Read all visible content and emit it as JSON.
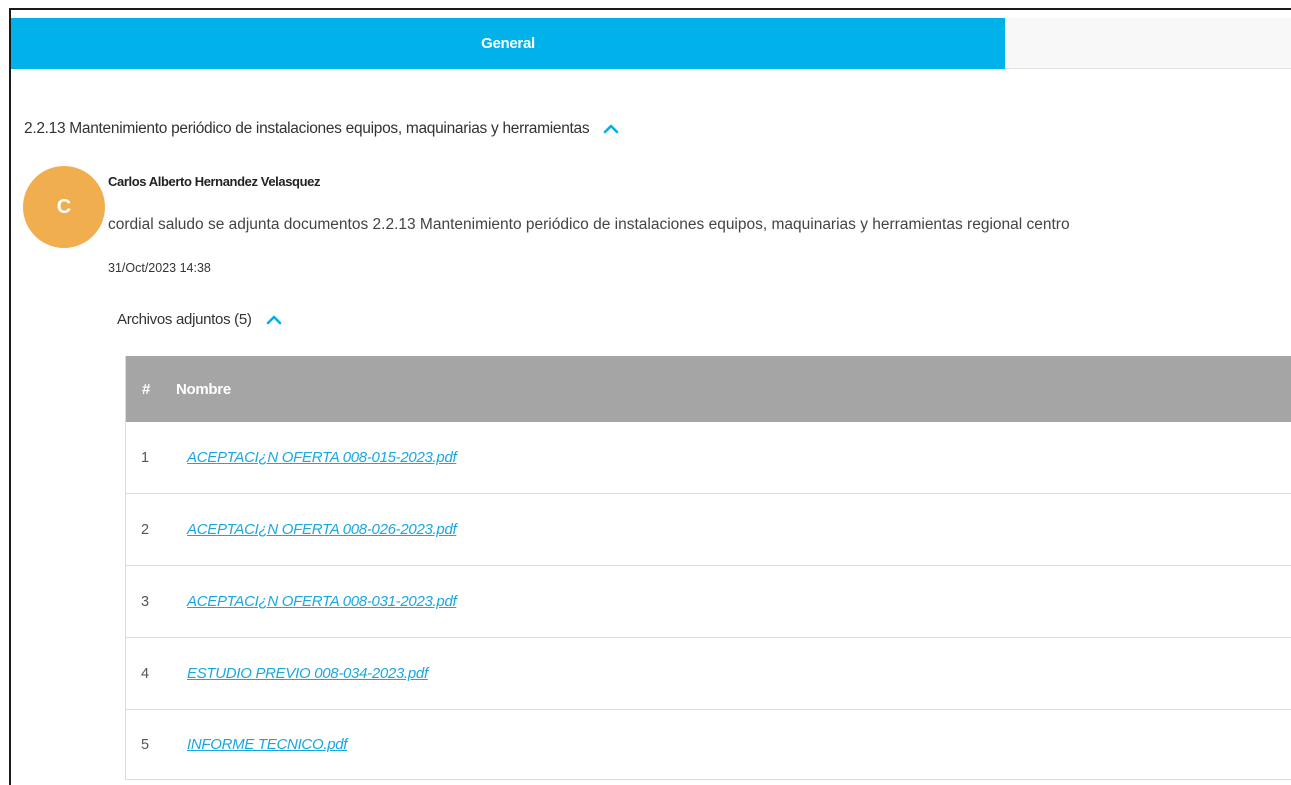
{
  "tabs": [
    {
      "label": "General"
    },
    {
      "label": ""
    }
  ],
  "section": {
    "title": "2.2.13 Mantenimiento periódico de instalaciones equipos, maquinarias y herramientas"
  },
  "comment": {
    "avatar_letter": "C",
    "author": "Carlos Alberto Hernandez Velasquez",
    "text": "cordial saludo se adjunta documentos 2.2.13 Mantenimiento periódico de instalaciones equipos, maquinarias y herramientas regional centro",
    "date": "31/Oct/2023 14:38"
  },
  "attachments": {
    "title": "Archivos adjuntos (5)",
    "columns": [
      "#",
      "Nombre"
    ],
    "rows": [
      {
        "num": "1",
        "name": "ACEPTACI¿N OFERTA 008-015-2023.pdf"
      },
      {
        "num": "2",
        "name": "ACEPTACI¿N OFERTA 008-026-2023.pdf"
      },
      {
        "num": "3",
        "name": "ACEPTACI¿N OFERTA 008-031-2023.pdf"
      },
      {
        "num": "4",
        "name": "ESTUDIO PREVIO 008-034-2023.pdf"
      },
      {
        "num": "5",
        "name": "INFORME TECNICO.pdf"
      }
    ]
  },
  "colors": {
    "accent": "#00b1ea",
    "avatar": "#f0ae4f",
    "table_header": "#a5a5a5",
    "link": "#1aa7e0"
  },
  "icons": {
    "collapse": "chevron-up-icon"
  }
}
